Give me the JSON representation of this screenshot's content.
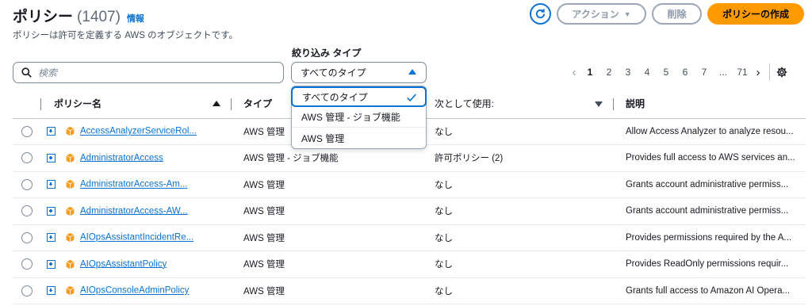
{
  "header": {
    "title": "ポリシー",
    "count": "(1407)",
    "info": "情報",
    "subtitle": "ポリシーは許可を定義する AWS のオブジェクトです。"
  },
  "toolbar": {
    "actions_label": "アクション",
    "delete_label": "削除",
    "create_label": "ポリシーの作成"
  },
  "filter": {
    "type_label": "絞り込み タイプ",
    "search_placeholder": "検索",
    "selected_type": "すべてのタイプ",
    "options": [
      "すべてのタイプ",
      "AWS 管理 - ジョブ機能",
      "AWS 管理"
    ]
  },
  "pagination": {
    "pages": [
      "1",
      "2",
      "3",
      "4",
      "5",
      "6",
      "7",
      "...",
      "71"
    ],
    "current": "1"
  },
  "table": {
    "columns": [
      "ポリシー名",
      "タイプ",
      "次として使用:",
      "説明"
    ],
    "rows": [
      {
        "name": "AccessAnalyzerServiceRol...",
        "type": "AWS 管理",
        "used_as": "なし",
        "description": "Allow Access Analyzer to analyze resou..."
      },
      {
        "name": "AdministratorAccess",
        "type": "AWS 管理 - ジョブ機能",
        "used_as": "許可ポリシー (2)",
        "description": "Provides full access to AWS services an..."
      },
      {
        "name": "AdministratorAccess-Am...",
        "type": "AWS 管理",
        "used_as": "なし",
        "description": "Grants account administrative permiss..."
      },
      {
        "name": "AdministratorAccess-AW...",
        "type": "AWS 管理",
        "used_as": "なし",
        "description": "Grants account administrative permiss..."
      },
      {
        "name": "AIOpsAssistantIncidentRe...",
        "type": "AWS 管理",
        "used_as": "なし",
        "description": "Provides permissions required by the A..."
      },
      {
        "name": "AIOpsAssistantPolicy",
        "type": "AWS 管理",
        "used_as": "なし",
        "description": "Provides ReadOnly permissions requir..."
      },
      {
        "name": "AIOpsConsoleAdminPolicy",
        "type": "AWS 管理",
        "used_as": "なし",
        "description": "Grants full access to Amazon AI Opera..."
      }
    ]
  },
  "colors": {
    "link": "#0972d3",
    "primary": "#ff9900",
    "policy_icon": "#f89b1c"
  },
  "icons": [
    "refresh-icon",
    "caret-down-icon",
    "search-icon",
    "settings-gear-icon",
    "expand-plus-icon",
    "policy-cube-icon",
    "checkmark-icon"
  ]
}
